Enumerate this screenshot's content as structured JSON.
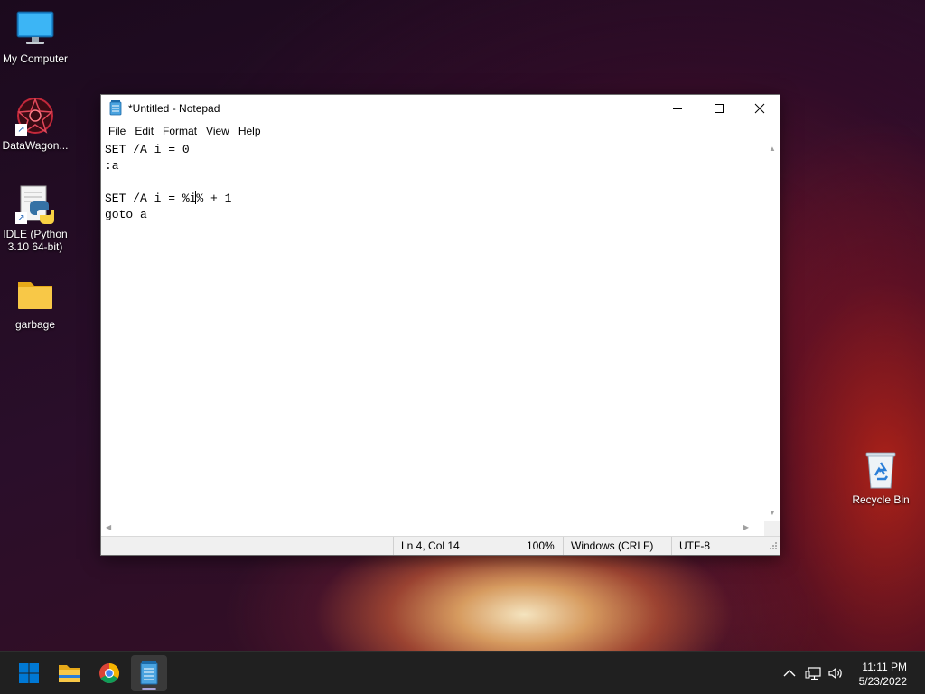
{
  "desktop": {
    "icons": [
      {
        "label": "My Computer",
        "icon": "monitor-icon"
      },
      {
        "label": "DataWagon...",
        "icon": "datawagon-app-icon"
      },
      {
        "label": "IDLE (Python 3.10 64-bit)",
        "icon": "python-idle-icon"
      },
      {
        "label": "garbage",
        "icon": "folder-icon"
      },
      {
        "label": "Recycle Bin",
        "icon": "recycle-bin-icon"
      }
    ]
  },
  "window": {
    "title": "*Untitled - Notepad",
    "controls": [
      "minimize",
      "maximize",
      "close"
    ],
    "menu": [
      "File",
      "Edit",
      "Format",
      "View",
      "Help"
    ],
    "editor_lines": [
      "SET /A i = 0",
      ":a",
      "",
      "SET /A i = %i% + 1",
      "goto a"
    ],
    "status": {
      "position": "Ln 4, Col 14",
      "zoom": "100%",
      "line_ending": "Windows (CRLF)",
      "encoding": "UTF-8"
    }
  },
  "taskbar": {
    "apps": [
      "start",
      "file-explorer",
      "chrome",
      "notepad"
    ],
    "active_app": "notepad",
    "clock": {
      "time": "11:11 PM",
      "date": "5/23/2022"
    }
  },
  "colors": {
    "taskbar_bg": "#202020",
    "start_blue": "#0078d4",
    "folder_yellow": "#f8c847",
    "notepad_blue": "#4aa3df"
  }
}
